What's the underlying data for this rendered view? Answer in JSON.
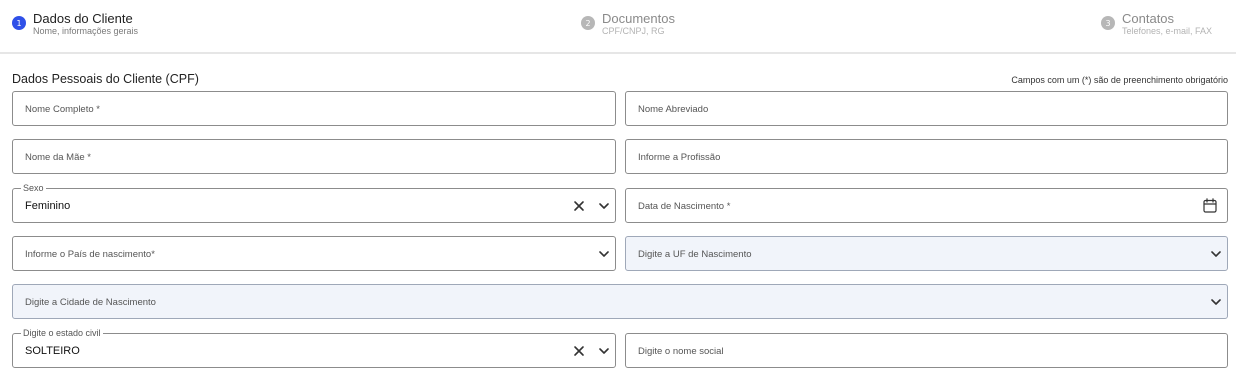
{
  "steps": [
    {
      "number": "1",
      "title": "Dados do Cliente",
      "subtitle": "Nome, informações gerais"
    },
    {
      "number": "2",
      "title": "Documentos",
      "subtitle": "CPF/CNPJ, RG"
    },
    {
      "number": "3",
      "title": "Contatos",
      "subtitle": "Telefones, e-mail, FAX"
    }
  ],
  "section": {
    "title": "Dados Pessoais do Cliente (CPF)",
    "required_note": "Campos com um (*) são de preenchimento obrigatório"
  },
  "fields": {
    "nome_completo": {
      "placeholder": "Nome Completo *"
    },
    "nome_abreviado": {
      "placeholder": "Nome Abreviado"
    },
    "nome_mae": {
      "placeholder": "Nome da Mãe *"
    },
    "profissao": {
      "placeholder": "Informe a Profissão"
    },
    "sexo": {
      "label": "Sexo",
      "value": "Feminino"
    },
    "data_nascimento": {
      "placeholder": "Data de Nascimento *"
    },
    "pais_nascimento": {
      "placeholder": "Informe o País de nascimento*"
    },
    "uf_nascimento": {
      "placeholder": "Digite a UF de Nascimento"
    },
    "cidade_nascimento": {
      "placeholder": "Digite a Cidade de Nascimento"
    },
    "estado_civil": {
      "label": "Digite o estado civil",
      "value": "SOLTEIRO"
    },
    "nome_social": {
      "placeholder": "Digite o nome social"
    }
  },
  "icons": {
    "clear": "close-icon",
    "dropdown": "chevron-down-icon",
    "calendar": "calendar-icon"
  },
  "colors": {
    "accent": "#2f50e8",
    "disabled_bg": "#f1f4fa"
  }
}
